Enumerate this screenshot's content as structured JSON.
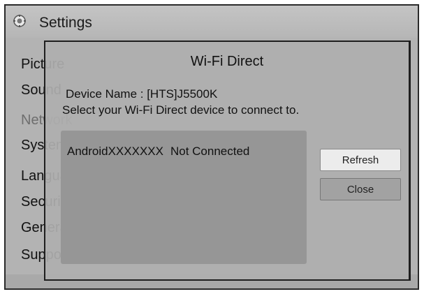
{
  "header": {
    "title": "Settings",
    "icon": "gear-icon"
  },
  "sidebar": {
    "items": [
      {
        "label": "Picture"
      },
      {
        "label": "Sound"
      },
      {
        "label": "Network",
        "selected": true
      },
      {
        "label": "System"
      },
      {
        "label": "Language"
      },
      {
        "label": "Security"
      },
      {
        "label": "General"
      },
      {
        "label": "Support"
      }
    ]
  },
  "dialog": {
    "title": "Wi-Fi Direct",
    "device_name_line": "Device Name : [HTS]J5500K",
    "instruction": "Select your Wi-Fi Direct device to connect to.",
    "devices": [
      {
        "name": "AndroidXXXXXXX",
        "status": "Not Connected"
      }
    ],
    "buttons": {
      "refresh": "Refresh",
      "close": "Close"
    }
  },
  "colors": {
    "screen_bg": "#b3b3b3",
    "dialog_bg": "#afafaf",
    "list_bg": "#969696",
    "focused_button": "#ececec"
  }
}
